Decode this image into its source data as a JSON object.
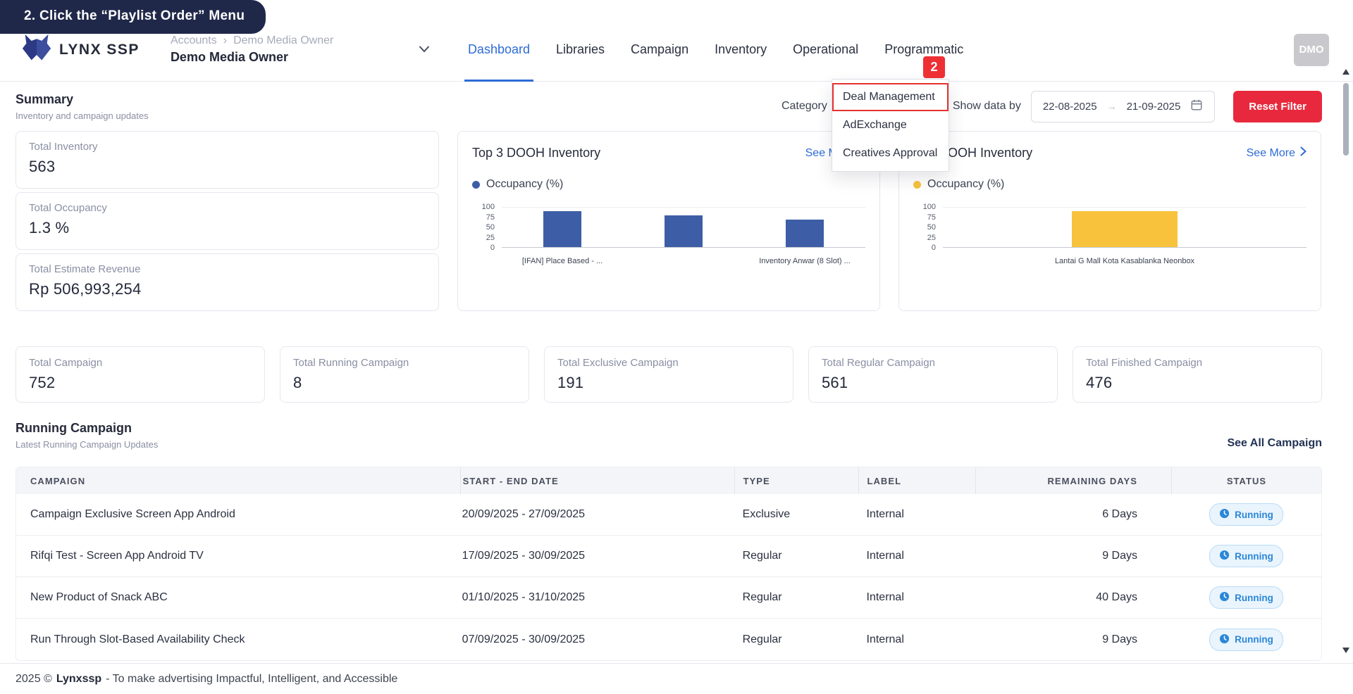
{
  "annotation": {
    "callout_text": "2. Click the “Playlist Order” Menu",
    "step_number": "2"
  },
  "header": {
    "logo_text": "LYNX SSP",
    "breadcrumb": {
      "root": "Accounts",
      "separator": "›",
      "parent": "Demo Media Owner"
    },
    "account_name": "Demo Media Owner",
    "nav_items": [
      {
        "label": "Dashboard",
        "active": true
      },
      {
        "label": "Libraries",
        "active": false
      },
      {
        "label": "Campaign",
        "active": false
      },
      {
        "label": "Inventory",
        "active": false
      },
      {
        "label": "Operational",
        "active": false
      },
      {
        "label": "Programmatic",
        "active": false
      }
    ],
    "avatar_initials": "DMO"
  },
  "programmatic_menu": {
    "items": [
      {
        "label": "Deal Management",
        "highlighted": true
      },
      {
        "label": "AdExchange",
        "highlighted": false
      },
      {
        "label": "Creatives Approval",
        "highlighted": false
      }
    ]
  },
  "summary": {
    "title": "Summary",
    "subtitle": "Inventory and campaign updates",
    "filters": {
      "category_label": "Category",
      "show_data_label": "Show data by",
      "date_from": "22-08-2025",
      "date_to": "21-09-2025",
      "date_separator": "→",
      "reset_button": "Reset Filter"
    },
    "kpi_cards": [
      {
        "label": "Total Inventory",
        "value": "563"
      },
      {
        "label": "Total Occupancy",
        "value": "1.3 %"
      },
      {
        "label": "Total Estimate Revenue",
        "value": "Rp 506,993,254"
      }
    ]
  },
  "chart_data": [
    {
      "type": "bar",
      "title": "Top 3 DOOH Inventory",
      "see_more": "See More",
      "legend": "Occupancy (%)",
      "color": "#3d5ea6",
      "categories": [
        "[IFAN] Place Based - ...",
        "",
        "Inventory Anwar (8 Slot) ..."
      ],
      "values": [
        91,
        81,
        70
      ],
      "ylim": [
        0,
        100
      ],
      "yticks": [
        "100",
        "75",
        "50",
        "25",
        "0"
      ],
      "legend_position": "top-left",
      "grid": false
    },
    {
      "type": "bar",
      "title": "Top 3 OOH Inventory",
      "see_more": "See More",
      "legend": "Occupancy (%)",
      "color": "#f8c23c",
      "categories": [
        "Lantai G Mall Kota Kasablanka Neonbox"
      ],
      "values": [
        91
      ],
      "ylim": [
        0,
        100
      ],
      "yticks": [
        "100",
        "75",
        "50",
        "25",
        "0"
      ],
      "legend_position": "top-left",
      "grid": false
    }
  ],
  "stats": [
    {
      "label": "Total Campaign",
      "value": "752"
    },
    {
      "label": "Total Running Campaign",
      "value": "8"
    },
    {
      "label": "Total Exclusive Campaign",
      "value": "191"
    },
    {
      "label": "Total Regular Campaign",
      "value": "561"
    },
    {
      "label": "Total Finished Campaign",
      "value": "476"
    }
  ],
  "running_campaign": {
    "title": "Running Campaign",
    "subtitle": "Latest Running Campaign Updates",
    "see_all": "See All Campaign",
    "table": {
      "headers": [
        "CAMPAIGN",
        "START - END DATE",
        "TYPE",
        "LABEL",
        "REMAINING DAYS",
        "STATUS"
      ],
      "rows": [
        {
          "campaign": "Campaign Exclusive Screen App Android",
          "dates": "20/09/2025 - 27/09/2025",
          "type": "Exclusive",
          "label": "Internal",
          "days": "6 Days",
          "status": "Running"
        },
        {
          "campaign": "Rifqi Test - Screen App Android TV",
          "dates": "17/09/2025 - 30/09/2025",
          "type": "Regular",
          "label": "Internal",
          "days": "9 Days",
          "status": "Running"
        },
        {
          "campaign": "New Product of Snack ABC",
          "dates": "01/10/2025 - 31/10/2025",
          "type": "Regular",
          "label": "Internal",
          "days": "40 Days",
          "status": "Running"
        },
        {
          "campaign": "Run Through Slot-Based Availability Check",
          "dates": "07/09/2025 - 30/09/2025",
          "type": "Regular",
          "label": "Internal",
          "days": "9 Days",
          "status": "Running"
        }
      ]
    }
  },
  "footer": {
    "prefix": "2025 ©",
    "brand": "Lynxssp",
    "tagline": "- To make advertising Impactful, Intelligent, and Accessible"
  },
  "colors": {
    "accent_blue": "#2e6bd6",
    "bar_blue": "#3d5ea6",
    "bar_yellow": "#f8c23c",
    "danger_red": "#e8293d",
    "badge_red": "#ee2f33",
    "status_blue": "#2b87d8",
    "callout_bg": "#20284a"
  }
}
